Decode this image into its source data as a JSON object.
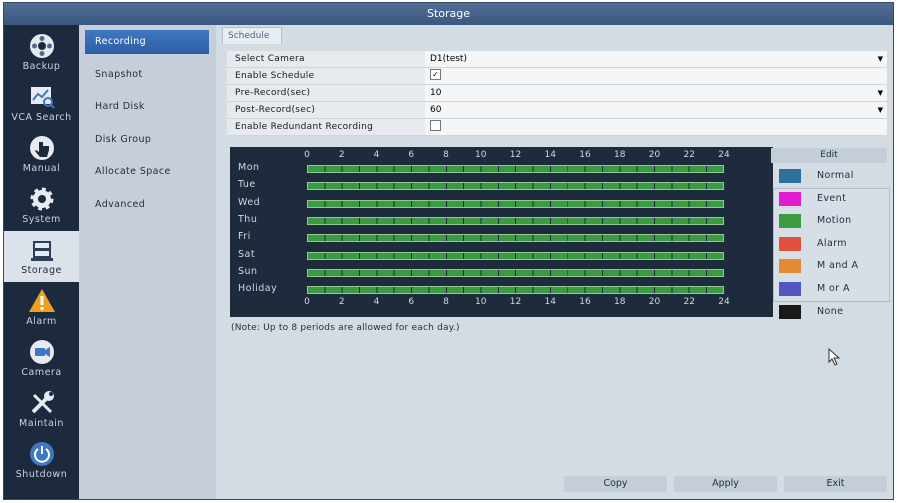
{
  "window": {
    "title": "Storage"
  },
  "nav": [
    {
      "label": "Backup",
      "icon": "backup-icon"
    },
    {
      "label": "VCA Search",
      "icon": "vca-search-icon"
    },
    {
      "label": "Manual",
      "icon": "manual-icon"
    },
    {
      "label": "System",
      "icon": "gear-icon"
    },
    {
      "label": "Storage",
      "icon": "storage-icon",
      "active": true
    },
    {
      "label": "Alarm",
      "icon": "alarm-icon"
    },
    {
      "label": "Camera",
      "icon": "camera-icon"
    },
    {
      "label": "Maintain",
      "icon": "maintain-icon"
    },
    {
      "label": "Shutdown",
      "icon": "power-icon"
    }
  ],
  "subnav": [
    {
      "label": "Recording",
      "active": true
    },
    {
      "label": "Snapshot"
    },
    {
      "label": "Hard Disk"
    },
    {
      "label": "Disk Group"
    },
    {
      "label": "Allocate Space"
    },
    {
      "label": "Advanced"
    }
  ],
  "tab": {
    "label": "Schedule"
  },
  "form": {
    "camera": {
      "label": "Select Camera",
      "value": "D1(test)"
    },
    "enable_schedule": {
      "label": "Enable Schedule",
      "checked": true,
      "mark": "✓"
    },
    "pre_record": {
      "label": "Pre-Record(sec)",
      "value": "10"
    },
    "post_record": {
      "label": "Post-Record(sec)",
      "value": "60"
    },
    "redundant": {
      "label": "Enable Redundant Recording",
      "checked": false
    }
  },
  "schedule": {
    "hours": [
      "0",
      "2",
      "4",
      "6",
      "8",
      "10",
      "12",
      "14",
      "16",
      "18",
      "20",
      "22",
      "24"
    ],
    "days": [
      {
        "label": "Mon",
        "mode": "Motion",
        "start": 0,
        "end": 24
      },
      {
        "label": "Tue",
        "mode": "Motion",
        "start": 0,
        "end": 24
      },
      {
        "label": "Wed",
        "mode": "Motion",
        "start": 0,
        "end": 24
      },
      {
        "label": "Thu",
        "mode": "Motion",
        "start": 0,
        "end": 24
      },
      {
        "label": "Fri",
        "mode": "Motion",
        "start": 0,
        "end": 24
      },
      {
        "label": "Sat",
        "mode": "Motion",
        "start": 0,
        "end": 24
      },
      {
        "label": "Sun",
        "mode": "Motion",
        "start": 0,
        "end": 24
      },
      {
        "label": "Holiday",
        "mode": "Motion",
        "start": 0,
        "end": 24
      }
    ],
    "note": "(Note: Up to 8 periods are allowed for each day.)"
  },
  "edit_label": "Edit",
  "legend": [
    {
      "label": "Normal",
      "color": "#2f6f9c"
    },
    {
      "label": "Event",
      "color": "#e01bd0"
    },
    {
      "label": "Motion",
      "color": "#3c9a43"
    },
    {
      "label": "Alarm",
      "color": "#e0503c"
    },
    {
      "label": "M and A",
      "color": "#e48a34"
    },
    {
      "label": "M or A",
      "color": "#5454c0"
    },
    {
      "label": "None",
      "color": "#1a1a1a"
    }
  ],
  "buttons": {
    "copy": "Copy",
    "apply": "Apply",
    "exit": "Exit"
  }
}
